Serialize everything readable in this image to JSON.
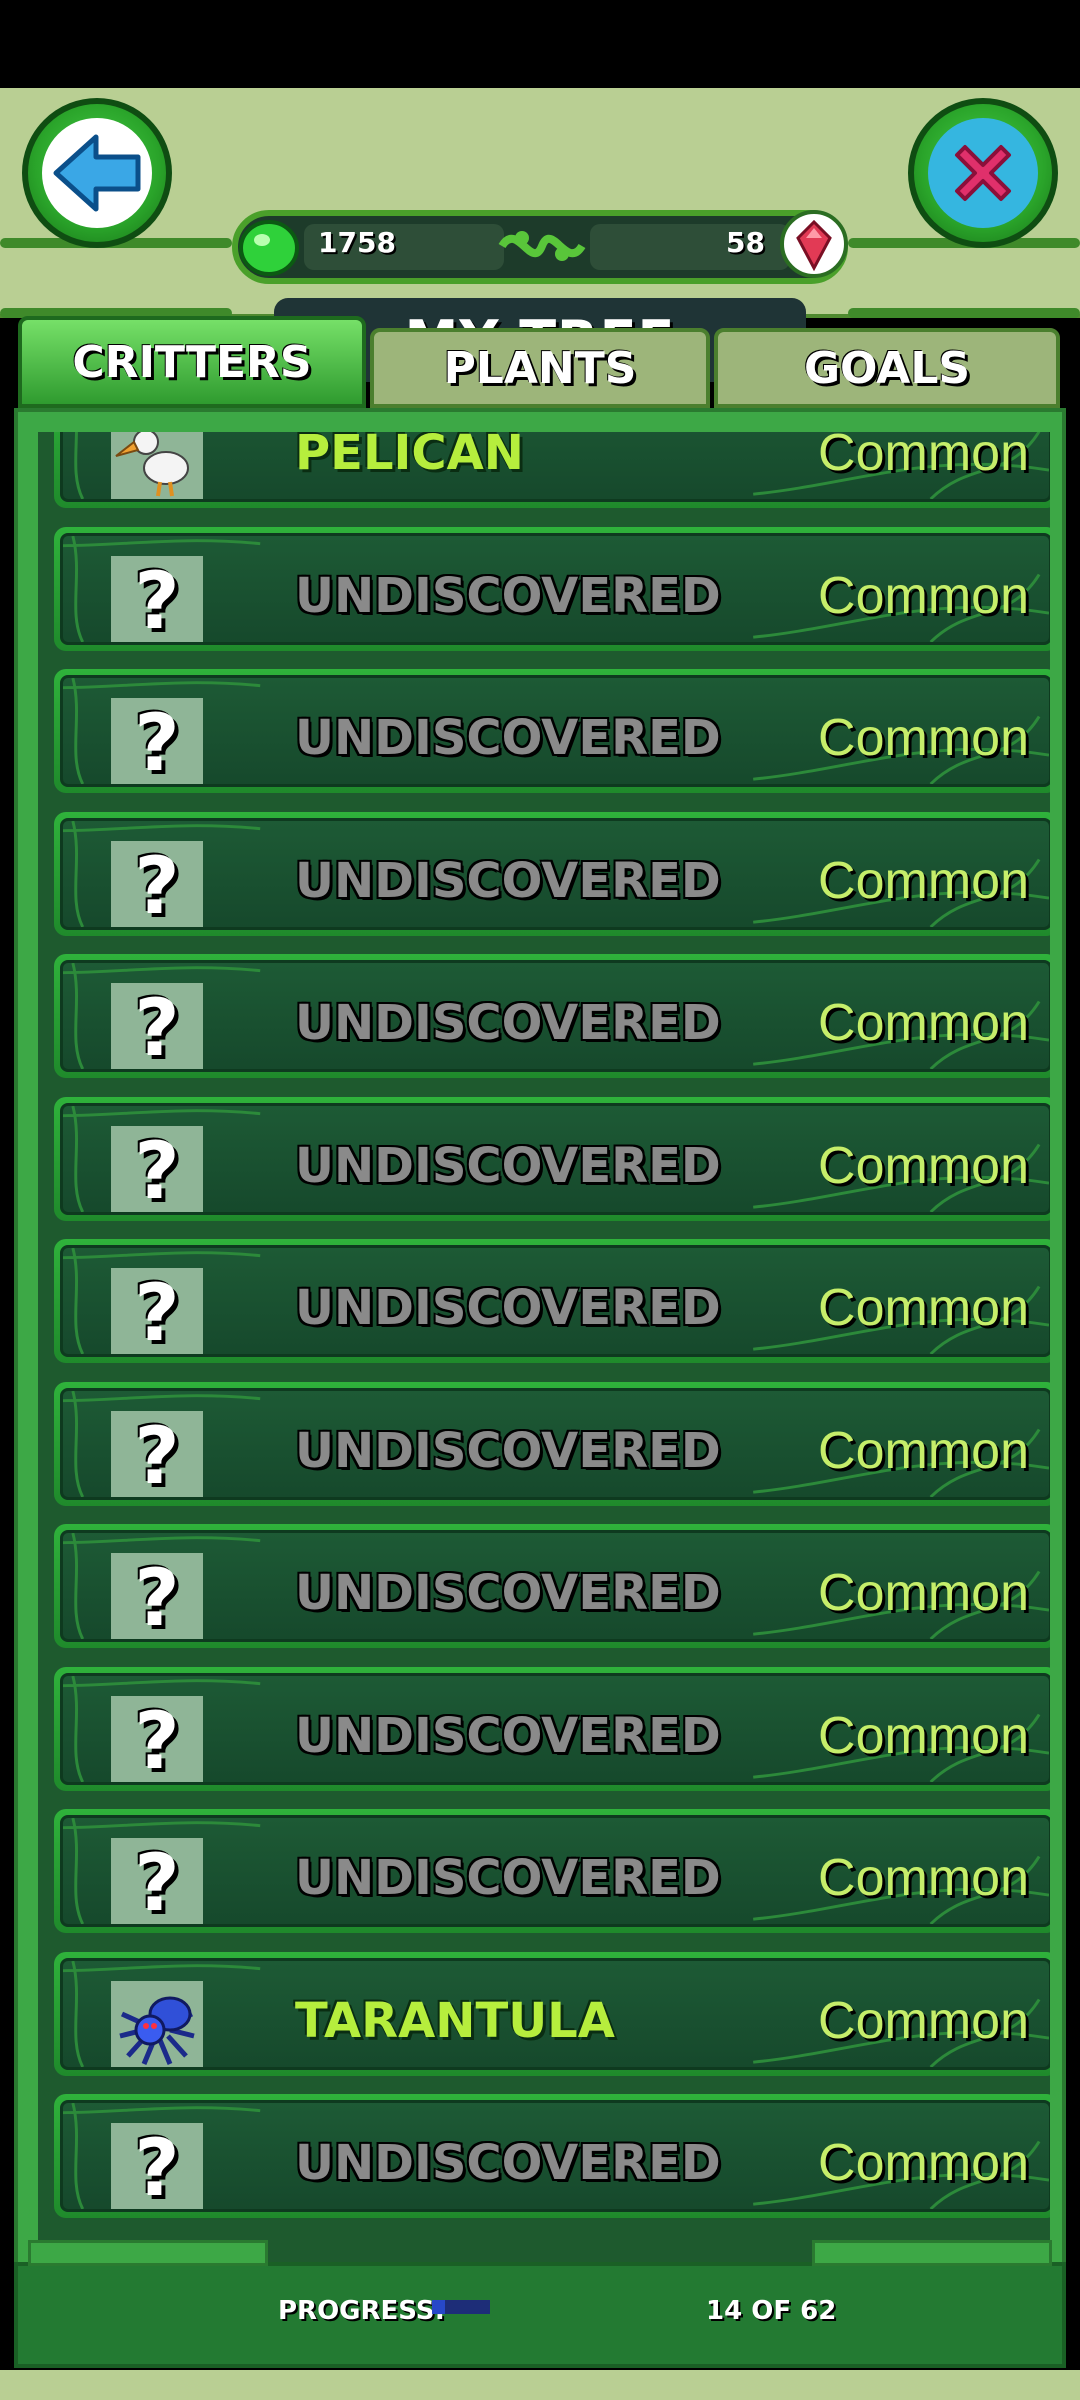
{
  "header": {
    "title": "MY TREE",
    "gems_green": "1758",
    "gems_red": "58",
    "back_icon": "left-arrow-icon",
    "close_icon": "x-icon"
  },
  "tabs": [
    {
      "label": "CRITTERS",
      "active": true
    },
    {
      "label": "PLANTS",
      "active": false
    },
    {
      "label": "GOALS",
      "active": false
    }
  ],
  "critters": [
    {
      "name": "PELICAN",
      "rarity": "Common",
      "discovered": true,
      "icon": "pelican-icon"
    },
    {
      "name": "UNDISCOVERED",
      "rarity": "Common",
      "discovered": false,
      "icon": "question-mark-icon"
    },
    {
      "name": "UNDISCOVERED",
      "rarity": "Common",
      "discovered": false,
      "icon": "question-mark-icon"
    },
    {
      "name": "UNDISCOVERED",
      "rarity": "Common",
      "discovered": false,
      "icon": "question-mark-icon"
    },
    {
      "name": "UNDISCOVERED",
      "rarity": "Common",
      "discovered": false,
      "icon": "question-mark-icon"
    },
    {
      "name": "UNDISCOVERED",
      "rarity": "Common",
      "discovered": false,
      "icon": "question-mark-icon"
    },
    {
      "name": "UNDISCOVERED",
      "rarity": "Common",
      "discovered": false,
      "icon": "question-mark-icon"
    },
    {
      "name": "UNDISCOVERED",
      "rarity": "Common",
      "discovered": false,
      "icon": "question-mark-icon"
    },
    {
      "name": "UNDISCOVERED",
      "rarity": "Common",
      "discovered": false,
      "icon": "question-mark-icon"
    },
    {
      "name": "UNDISCOVERED",
      "rarity": "Common",
      "discovered": false,
      "icon": "question-mark-icon"
    },
    {
      "name": "UNDISCOVERED",
      "rarity": "Common",
      "discovered": false,
      "icon": "question-mark-icon"
    },
    {
      "name": "TARANTULA",
      "rarity": "Common",
      "discovered": true,
      "icon": "tarantula-icon"
    },
    {
      "name": "UNDISCOVERED",
      "rarity": "Common",
      "discovered": false,
      "icon": "question-mark-icon"
    }
  ],
  "footer": {
    "progress_label": "PROGRESS:",
    "progress_count": "14 OF 62",
    "progress_fraction": 0.226
  },
  "colors": {
    "accent_green": "#3da846",
    "found_name": "#b6ee3d",
    "rarity_text": "#c6ee6a"
  }
}
